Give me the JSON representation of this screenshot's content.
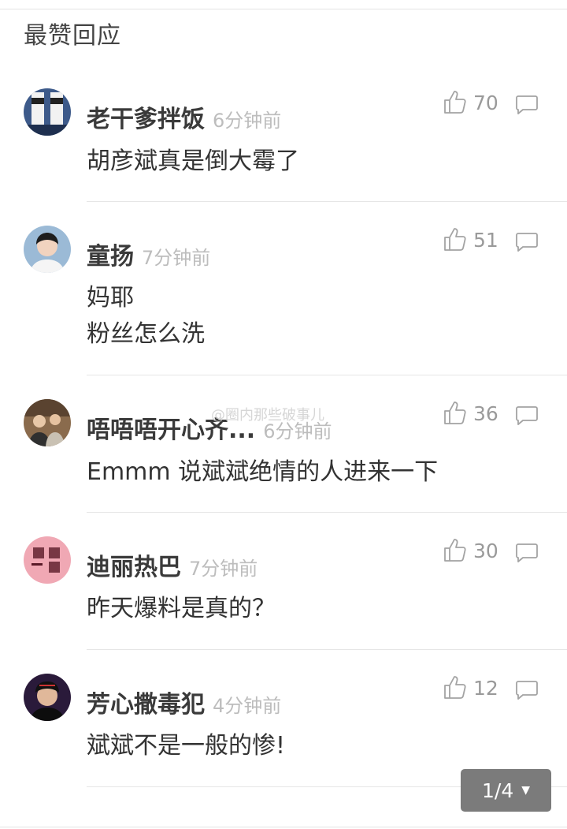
{
  "section": {
    "title": "最赞回应"
  },
  "comments": [
    {
      "name": "老干爹拌饭",
      "time": "6分钟前",
      "likes": "70",
      "lines": [
        "胡彦斌真是倒大霉了"
      ],
      "avatar_icon": "sock-avatar-icon"
    },
    {
      "name": "童扬",
      "time": "7分钟前",
      "likes": "51",
      "lines": [
        "妈耶",
        "粉丝怎么洗"
      ],
      "avatar_icon": "boy-avatar-icon"
    },
    {
      "name": "唔唔唔开心齐...",
      "time": "6分钟前",
      "likes": "36",
      "lines": [
        "Emmm 说斌斌绝情的人进来一下"
      ],
      "avatar_icon": "group-avatar-icon"
    },
    {
      "name": "迪丽热巴",
      "time": "7分钟前",
      "likes": "30",
      "lines": [
        "昨天爆料是真的？"
      ],
      "avatar_icon": "text-avatar-icon"
    },
    {
      "name": "芳心撒毒犯",
      "time": "4分钟前",
      "likes": "12",
      "lines": [
        "斌斌不是一般的惨!"
      ],
      "avatar_icon": "dark-avatar-icon"
    }
  ],
  "pager": {
    "label": "1/4",
    "caret": "▼"
  },
  "watermark": "@圈内那些破事儿"
}
